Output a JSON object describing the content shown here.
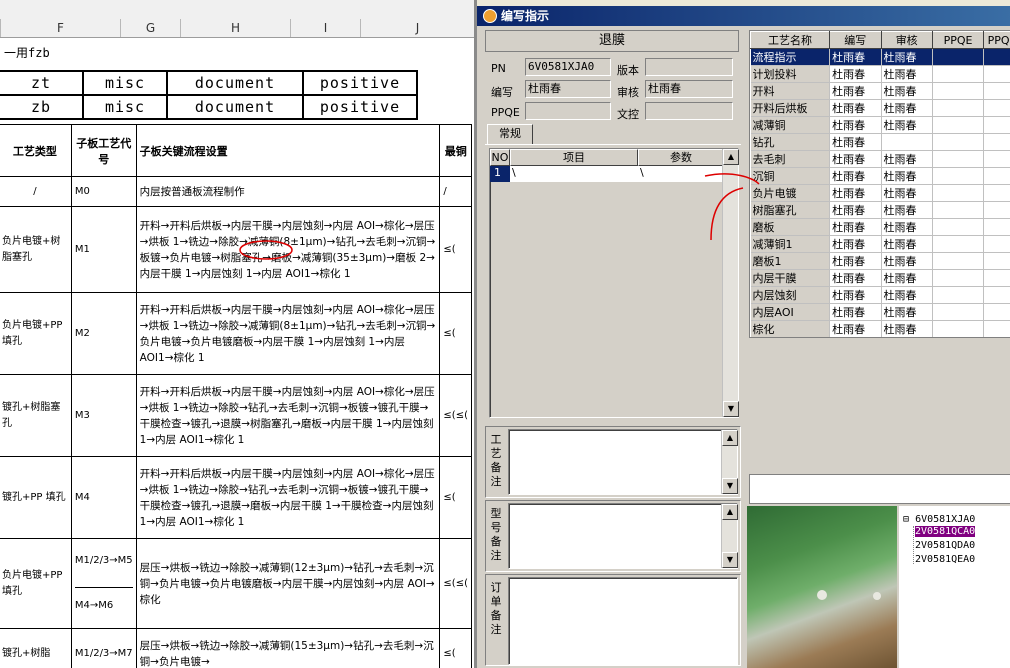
{
  "doc": {
    "columns": [
      "F",
      "G",
      "H",
      "I",
      "J"
    ],
    "line1": "一用fzb",
    "mini_rows": [
      [
        "zt",
        "misc",
        "document",
        "positive"
      ],
      [
        "zb",
        "misc",
        "document",
        "positive"
      ]
    ],
    "headers": [
      "工艺类型",
      "子板工艺代号",
      "子板关键流程设置",
      "最铜"
    ],
    "rows": [
      {
        "type": "/",
        "code": "M0",
        "flow": "内层按普通板流程制作",
        "last": "/"
      },
      {
        "type": "负片电镀+树脂塞孔",
        "code": "M1",
        "flow": "开料→开料后烘板→内层干膜→内层蚀刻→内层 AOI→棕化→层压→烘板 1→铣边→除胶→减薄铜(8±1μm)→钻孔→去毛刺→沉铜→板镀→负片电镀→树脂塞孔→磨板→减薄铜(35±3μm)→磨板 2→内层干膜 1→内层蚀刻 1→内层 AOI1→棕化 1",
        "last": "≤("
      },
      {
        "type": "负片电镀+PP 填孔",
        "code": "M2",
        "flow": "开料→开料后烘板→内层干膜→内层蚀刻→内层 AOI→棕化→层压→烘板 1→铣边→除胶→减薄铜(8±1μm)→钻孔→去毛刺→沉铜→负片电镀→负片电镀磨板→内层干膜 1→内层蚀刻 1→内层 AOI1→棕化 1",
        "last": "≤("
      },
      {
        "type": "镀孔+树脂塞孔",
        "code": "M3",
        "flow": "开料→开料后烘板→内层干膜→内层蚀刻→内层 AOI→棕化→层压→烘板 1→铣边→除胶→钻孔→去毛刺→沉铜→板镀→镀孔干膜→干膜检查→镀孔→退膜→树脂塞孔→磨板→内层干膜 1→内层蚀刻 1→内层 AOI1→棕化 1",
        "last": "≤(≤("
      },
      {
        "type": "镀孔+PP 填孔",
        "code": "M4",
        "flow": "开料→开料后烘板→内层干膜→内层蚀刻→内层 AOI→棕化→层压→烘板 1→铣边→除胶→钻孔→去毛刺→沉铜→板镀→镀孔干膜→干膜检查→镀孔→退膜→磨板→内层干膜 1→干膜检查→内层蚀刻 1→内层 AOI1→棕化 1",
        "last": "≤("
      },
      {
        "type": "负片电镀+PP 填孔",
        "code": "M1/2/3→M5",
        "code2": "M4→M6",
        "flow": "层压→烘板→铣边→除胶→减薄铜(12±3μm)→钻孔→去毛刺→沉铜→负片电镀→负片电镀磨板→内层干膜→内层蚀刻→内层 AOI→棕化",
        "last": "≤(≤("
      },
      {
        "type": "镀孔+树脂",
        "code": "M1/2/3→M7",
        "flow": "层压→烘板→铣边→除胶→减薄铜(15±3μm)→钻孔→去毛刺→沉铜→负片电镀→",
        "last": "≤("
      }
    ]
  },
  "window": {
    "title": "编写指示",
    "header_label": "退膜",
    "pn_label": "PN",
    "pn_value": "6V0581XJA0",
    "version_label": "版本",
    "version_value": "",
    "author_label": "编写",
    "author_value": "杜雨春",
    "review_label": "审核",
    "review_value": "杜雨春",
    "ppqe_label": "PPQE",
    "ppqe_value": "",
    "doc_ctrl_label": "文控",
    "doc_ctrl_value": "",
    "tab_label": "常规",
    "grid_headers": [
      "NO",
      "项目",
      "参数"
    ],
    "grid_row": [
      "1",
      "\\",
      "\\"
    ],
    "memo1_label": "工艺备注",
    "memo2_label": "型号备注",
    "memo3_label": "订单备注"
  },
  "process_table": {
    "headers": [
      "工艺名称",
      "编写",
      "审核",
      "PPQE",
      "PPQ"
    ],
    "rows": [
      [
        "流程指示",
        "杜雨春",
        "杜雨春"
      ],
      [
        "计划投料",
        "杜雨春",
        "杜雨春"
      ],
      [
        "开料",
        "杜雨春",
        "杜雨春"
      ],
      [
        "开料后烘板",
        "杜雨春",
        "杜雨春"
      ],
      [
        "减薄铜",
        "杜雨春",
        "杜雨春"
      ],
      [
        "钻孔",
        "杜雨春",
        ""
      ],
      [
        "去毛刺",
        "杜雨春",
        "杜雨春"
      ],
      [
        "沉铜",
        "杜雨春",
        "杜雨春"
      ],
      [
        "负片电镀",
        "杜雨春",
        "杜雨春"
      ],
      [
        "树脂塞孔",
        "杜雨春",
        "杜雨春"
      ],
      [
        "磨板",
        "杜雨春",
        "杜雨春"
      ],
      [
        "减薄铜1",
        "杜雨春",
        "杜雨春"
      ],
      [
        "磨板1",
        "杜雨春",
        "杜雨春"
      ],
      [
        "内层干膜",
        "杜雨春",
        "杜雨春"
      ],
      [
        "内层蚀刻",
        "杜雨春",
        "杜雨春"
      ],
      [
        "内层AOI",
        "杜雨春",
        "杜雨春"
      ],
      [
        "棕化",
        "杜雨春",
        "杜雨春"
      ]
    ]
  },
  "tree": {
    "root": "6V0581XJA0",
    "children": [
      "2V0581QCA0",
      "2V0581QDA0",
      "2V0581QEA0"
    ]
  }
}
